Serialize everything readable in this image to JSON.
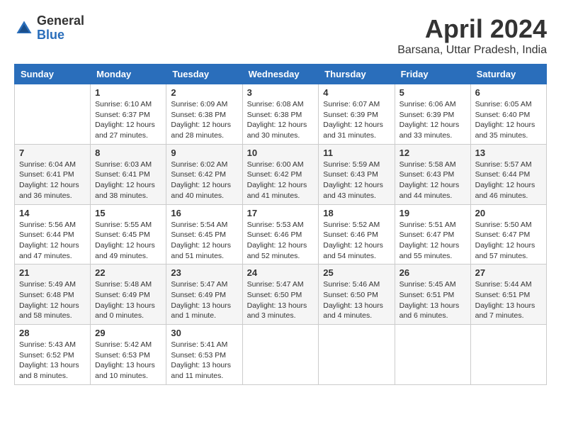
{
  "header": {
    "logo_general": "General",
    "logo_blue": "Blue",
    "title": "April 2024",
    "location": "Barsana, Uttar Pradesh, India"
  },
  "weekdays": [
    "Sunday",
    "Monday",
    "Tuesday",
    "Wednesday",
    "Thursday",
    "Friday",
    "Saturday"
  ],
  "weeks": [
    [
      {
        "day": "",
        "info": ""
      },
      {
        "day": "1",
        "info": "Sunrise: 6:10 AM\nSunset: 6:37 PM\nDaylight: 12 hours\nand 27 minutes."
      },
      {
        "day": "2",
        "info": "Sunrise: 6:09 AM\nSunset: 6:38 PM\nDaylight: 12 hours\nand 28 minutes."
      },
      {
        "day": "3",
        "info": "Sunrise: 6:08 AM\nSunset: 6:38 PM\nDaylight: 12 hours\nand 30 minutes."
      },
      {
        "day": "4",
        "info": "Sunrise: 6:07 AM\nSunset: 6:39 PM\nDaylight: 12 hours\nand 31 minutes."
      },
      {
        "day": "5",
        "info": "Sunrise: 6:06 AM\nSunset: 6:39 PM\nDaylight: 12 hours\nand 33 minutes."
      },
      {
        "day": "6",
        "info": "Sunrise: 6:05 AM\nSunset: 6:40 PM\nDaylight: 12 hours\nand 35 minutes."
      }
    ],
    [
      {
        "day": "7",
        "info": "Sunrise: 6:04 AM\nSunset: 6:41 PM\nDaylight: 12 hours\nand 36 minutes."
      },
      {
        "day": "8",
        "info": "Sunrise: 6:03 AM\nSunset: 6:41 PM\nDaylight: 12 hours\nand 38 minutes."
      },
      {
        "day": "9",
        "info": "Sunrise: 6:02 AM\nSunset: 6:42 PM\nDaylight: 12 hours\nand 40 minutes."
      },
      {
        "day": "10",
        "info": "Sunrise: 6:00 AM\nSunset: 6:42 PM\nDaylight: 12 hours\nand 41 minutes."
      },
      {
        "day": "11",
        "info": "Sunrise: 5:59 AM\nSunset: 6:43 PM\nDaylight: 12 hours\nand 43 minutes."
      },
      {
        "day": "12",
        "info": "Sunrise: 5:58 AM\nSunset: 6:43 PM\nDaylight: 12 hours\nand 44 minutes."
      },
      {
        "day": "13",
        "info": "Sunrise: 5:57 AM\nSunset: 6:44 PM\nDaylight: 12 hours\nand 46 minutes."
      }
    ],
    [
      {
        "day": "14",
        "info": "Sunrise: 5:56 AM\nSunset: 6:44 PM\nDaylight: 12 hours\nand 47 minutes."
      },
      {
        "day": "15",
        "info": "Sunrise: 5:55 AM\nSunset: 6:45 PM\nDaylight: 12 hours\nand 49 minutes."
      },
      {
        "day": "16",
        "info": "Sunrise: 5:54 AM\nSunset: 6:45 PM\nDaylight: 12 hours\nand 51 minutes."
      },
      {
        "day": "17",
        "info": "Sunrise: 5:53 AM\nSunset: 6:46 PM\nDaylight: 12 hours\nand 52 minutes."
      },
      {
        "day": "18",
        "info": "Sunrise: 5:52 AM\nSunset: 6:46 PM\nDaylight: 12 hours\nand 54 minutes."
      },
      {
        "day": "19",
        "info": "Sunrise: 5:51 AM\nSunset: 6:47 PM\nDaylight: 12 hours\nand 55 minutes."
      },
      {
        "day": "20",
        "info": "Sunrise: 5:50 AM\nSunset: 6:47 PM\nDaylight: 12 hours\nand 57 minutes."
      }
    ],
    [
      {
        "day": "21",
        "info": "Sunrise: 5:49 AM\nSunset: 6:48 PM\nDaylight: 12 hours\nand 58 minutes."
      },
      {
        "day": "22",
        "info": "Sunrise: 5:48 AM\nSunset: 6:49 PM\nDaylight: 13 hours\nand 0 minutes."
      },
      {
        "day": "23",
        "info": "Sunrise: 5:47 AM\nSunset: 6:49 PM\nDaylight: 13 hours\nand 1 minute."
      },
      {
        "day": "24",
        "info": "Sunrise: 5:47 AM\nSunset: 6:50 PM\nDaylight: 13 hours\nand 3 minutes."
      },
      {
        "day": "25",
        "info": "Sunrise: 5:46 AM\nSunset: 6:50 PM\nDaylight: 13 hours\nand 4 minutes."
      },
      {
        "day": "26",
        "info": "Sunrise: 5:45 AM\nSunset: 6:51 PM\nDaylight: 13 hours\nand 6 minutes."
      },
      {
        "day": "27",
        "info": "Sunrise: 5:44 AM\nSunset: 6:51 PM\nDaylight: 13 hours\nand 7 minutes."
      }
    ],
    [
      {
        "day": "28",
        "info": "Sunrise: 5:43 AM\nSunset: 6:52 PM\nDaylight: 13 hours\nand 8 minutes."
      },
      {
        "day": "29",
        "info": "Sunrise: 5:42 AM\nSunset: 6:53 PM\nDaylight: 13 hours\nand 10 minutes."
      },
      {
        "day": "30",
        "info": "Sunrise: 5:41 AM\nSunset: 6:53 PM\nDaylight: 13 hours\nand 11 minutes."
      },
      {
        "day": "",
        "info": ""
      },
      {
        "day": "",
        "info": ""
      },
      {
        "day": "",
        "info": ""
      },
      {
        "day": "",
        "info": ""
      }
    ]
  ]
}
